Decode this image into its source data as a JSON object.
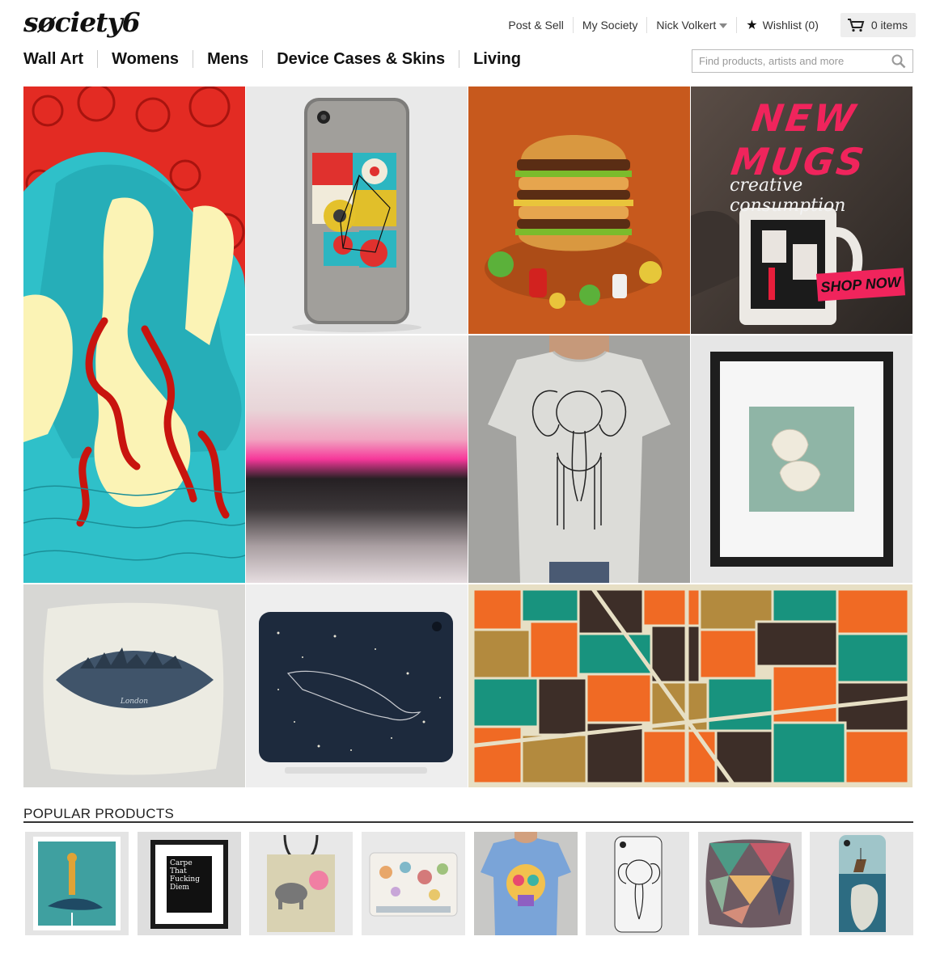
{
  "brand": {
    "logo": "søciety6"
  },
  "topnav": {
    "post_sell": "Post & Sell",
    "my_society": "My Society",
    "user_name": "Nick Volkert",
    "wishlist": "Wishlist (0)",
    "cart_label": "0 items"
  },
  "mainnav": {
    "items": [
      "Wall Art",
      "Womens",
      "Mens",
      "Device Cases & Skins",
      "Living"
    ]
  },
  "search": {
    "placeholder": "Find products, artists and more"
  },
  "promo": {
    "headline": "NEW MUGS",
    "script_text": "creative consumption",
    "cta": "SHOP NOW"
  },
  "pillow": {
    "caption": "London"
  },
  "frame_art": {
    "lines": [
      "Carpe",
      "That",
      "Fucking",
      "Diem"
    ]
  },
  "popular": {
    "title": "POPULAR PRODUCTS"
  },
  "colors": {
    "accent_pink": "#f0245c",
    "nav_text": "#111111",
    "rule": "#333333"
  }
}
